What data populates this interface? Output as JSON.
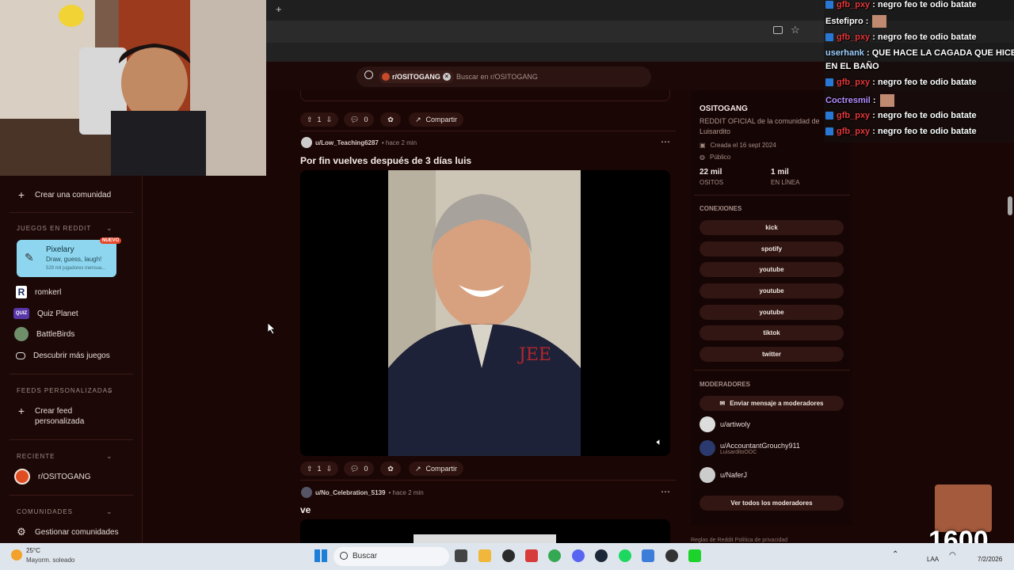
{
  "browser": {
    "new_tab": "+"
  },
  "search": {
    "community_chip": "r/OSITOGANG",
    "placeholder": "Buscar en r/OSITOGANG"
  },
  "sidebar": {
    "create_community": "Crear una comunidad",
    "games_header": "JUEGOS EN REDDIT",
    "featured_game": {
      "name": "Pixelary",
      "tagline": "Draw, guess, laugh!",
      "players": "529 mil jugadores mensua...",
      "badge": "NUEVO"
    },
    "games": [
      {
        "name": "romkerl"
      },
      {
        "name": "Quiz Planet"
      },
      {
        "name": "BattleBirds"
      }
    ],
    "discover_games": "Descubrir más juegos",
    "feeds_header": "FEEDS PERSONALIZADAS",
    "create_feed": "Crear feed personalizada",
    "recent_header": "RECIENTE",
    "recent_item": "r/OSITOGANG",
    "communities_header": "COMUNIDADES",
    "manage_communities": "Gestionar comunidades"
  },
  "feed": {
    "top_actions": {
      "votes": "1",
      "comments": "0",
      "share": "Compartir"
    },
    "post1": {
      "user": "u/Low_Teaching6287",
      "time": "• hace 2 min",
      "title": "Por fin vuelves después de 3 días luis",
      "votes": "1",
      "comments": "0",
      "share": "Compartir"
    },
    "post2": {
      "user": "u/No_Celebration_5139",
      "time": "• hace 2 min",
      "title": "ve"
    }
  },
  "community": {
    "name": "OSITOGANG",
    "description": "REDDIT OFICIAL de la comunidad de Luisardito",
    "created": "Creada el 16 sept 2024",
    "visibility": "Público",
    "members_value": "22 mil",
    "members_label": "OSITOS",
    "online_value": "1 mil",
    "online_label": "EN LÍNEA",
    "connections_header": "CONEXIONES",
    "connections": [
      "kick",
      "spotify",
      "youtube",
      "youtube",
      "youtube",
      "tiktok",
      "twitter"
    ],
    "moderators_header": "MODERADORES",
    "message_mods": "Enviar mensaje a moderadores",
    "moderators": [
      {
        "name": "u/artiwoly",
        "flair": ""
      },
      {
        "name": "u/AccountantGrouchy911",
        "flair": "LuisarditoOOC"
      },
      {
        "name": "u/NaferJ",
        "flair": ""
      }
    ],
    "all_mods": "Ver todos los moderadores",
    "footer": "Reglas de Reddit   Política de privacidad"
  },
  "chat": [
    {
      "user": "gfb_pxy",
      "msg": "negro feo te odio batate",
      "color": "#e0373a"
    },
    {
      "user": "Estefipro",
      "msg": "",
      "color": "#ffffff"
    },
    {
      "user": "gfb_pxy",
      "msg": "negro feo te odio batate",
      "color": "#e0373a"
    },
    {
      "user": "userhank",
      "msg": "QUE HACE LA CAGADA QUE HICE",
      "color": "#9fd0ff"
    },
    {
      "user": "",
      "msg": "EN EL BAÑO",
      "color": "#ffffff"
    },
    {
      "user": "gfb_pxy",
      "msg": "negro feo te odio batate",
      "color": "#e0373a"
    },
    {
      "user": "Coctresmil",
      "msg": "",
      "color": "#b48cff"
    },
    {
      "user": "gfb_pxy",
      "msg": "negro feo te odio batate",
      "color": "#e0373a"
    },
    {
      "user": "gfb_pxy",
      "msg": "negro feo te odio batate",
      "color": "#e0373a"
    }
  ],
  "overlay": {
    "counter": "1600"
  },
  "taskbar": {
    "weather_temp": "25°C",
    "weather_desc": "Mayorm. soleado",
    "search": "Buscar",
    "lang": "LAA",
    "date": "7/2/2026"
  },
  "colors": {
    "accent": "#d93a00",
    "background": "#1a0605"
  }
}
